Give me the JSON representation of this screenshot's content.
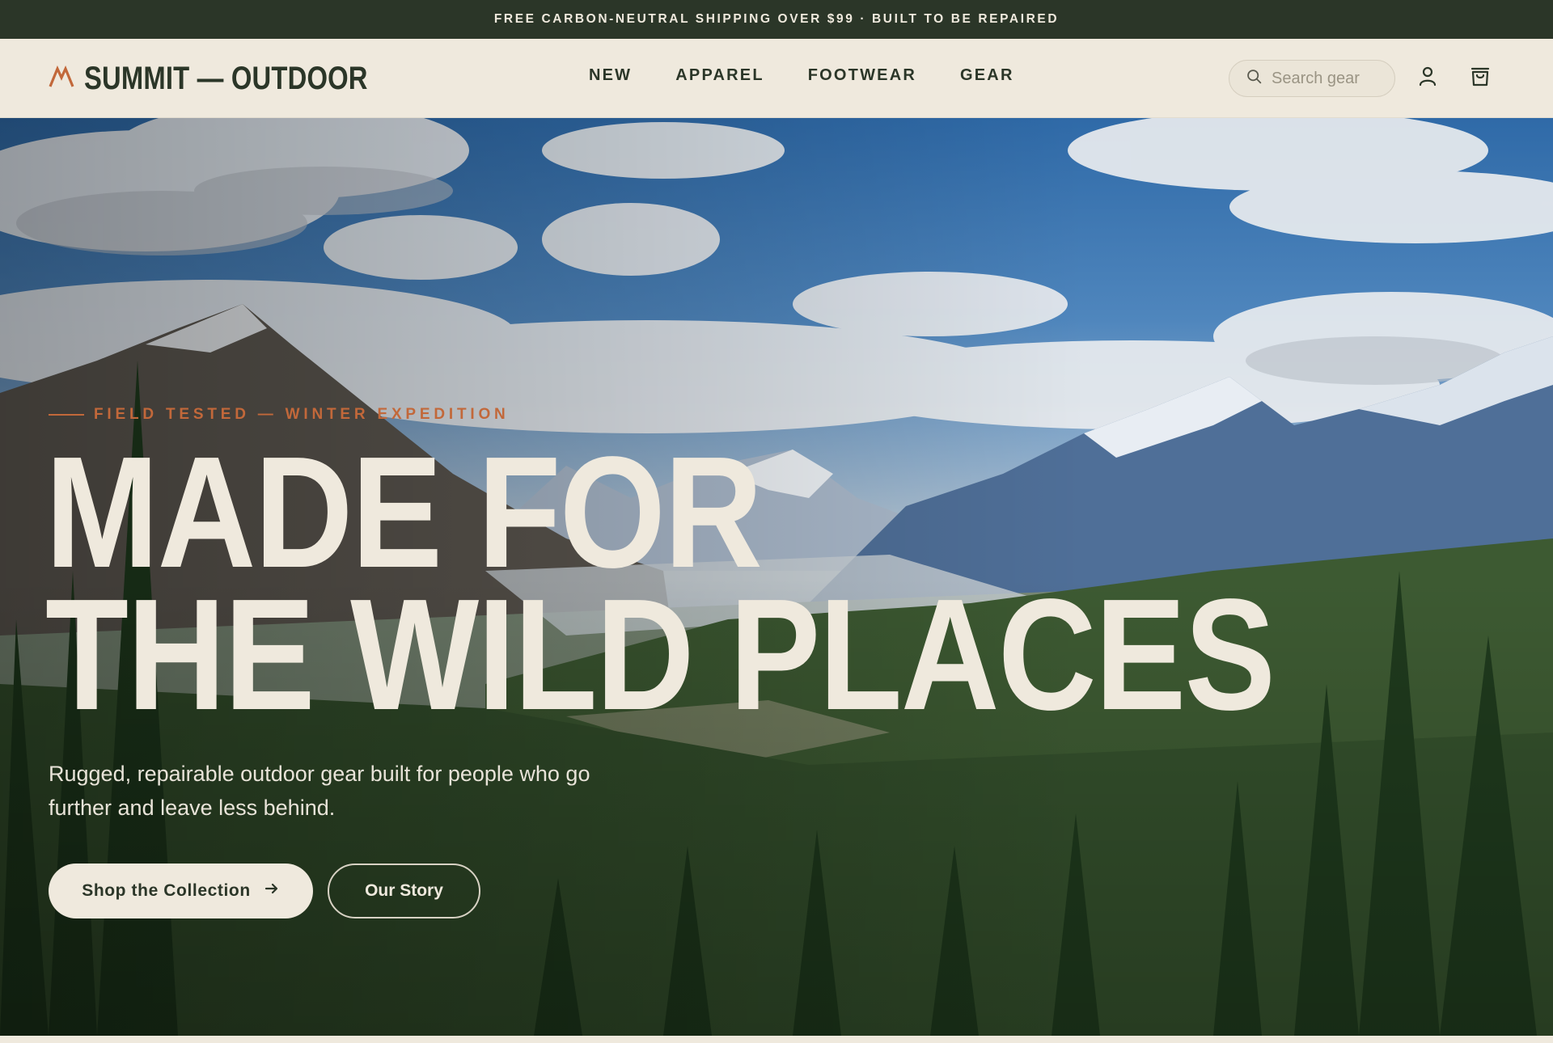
{
  "announcement": "FREE CARBON-NEUTRAL SHIPPING OVER $99 · BUILT TO BE REPAIRED",
  "header": {
    "logo_text": "SUMMIT — OUTDOOR",
    "logo_icon": "mountain-icon",
    "nav": [
      "NEW",
      "APPAREL",
      "FOOTWEAR",
      "GEAR"
    ],
    "search_placeholder": "Search gear",
    "icons": [
      "search-icon",
      "account-icon",
      "cart-icon"
    ]
  },
  "hero": {
    "eyebrow": "FIELD TESTED — WINTER EXPEDITION",
    "headline_line1": "MADE FOR",
    "headline_line2": "THE WILD PLACES",
    "subtitle": "Rugged, repairable outdoor gear built for people who go further and leave less behind.",
    "primary_cta": "Shop the Collection",
    "secondary_cta": "Our Story"
  },
  "colors": {
    "brand_dark": "#2b3628",
    "cream": "#efe9dd",
    "accent": "#c2683a"
  }
}
